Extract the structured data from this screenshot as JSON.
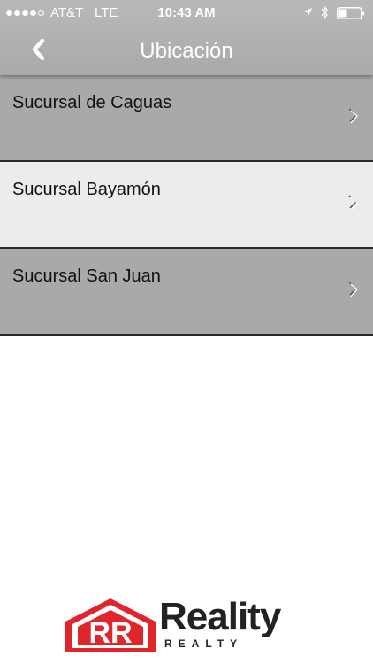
{
  "status_bar": {
    "signal_dots_filled": 4,
    "signal_dots_total": 5,
    "carrier": "AT&T",
    "network": "LTE",
    "time": "10:43 AM",
    "icons": [
      "location-arrow-icon",
      "bluetooth-icon",
      "battery-icon"
    ]
  },
  "nav": {
    "back_icon": "chevron-left-icon",
    "title": "Ubicación",
    "background_color": "#aaaaaa",
    "title_color": "#ffffff"
  },
  "branches": [
    {
      "label": "Sucursal de Caguas",
      "icon": "chevron-right-icon",
      "highlighted": false
    },
    {
      "label": "Sucursal Bayamón",
      "icon": "chevron-right-icon",
      "highlighted": true
    },
    {
      "label": "Sucursal San Juan",
      "icon": "chevron-right-icon",
      "highlighted": false
    }
  ],
  "logo": {
    "mark_text": "RR",
    "name": "Reality",
    "subtext": "REALTY",
    "accent_color": "#e0262b"
  }
}
